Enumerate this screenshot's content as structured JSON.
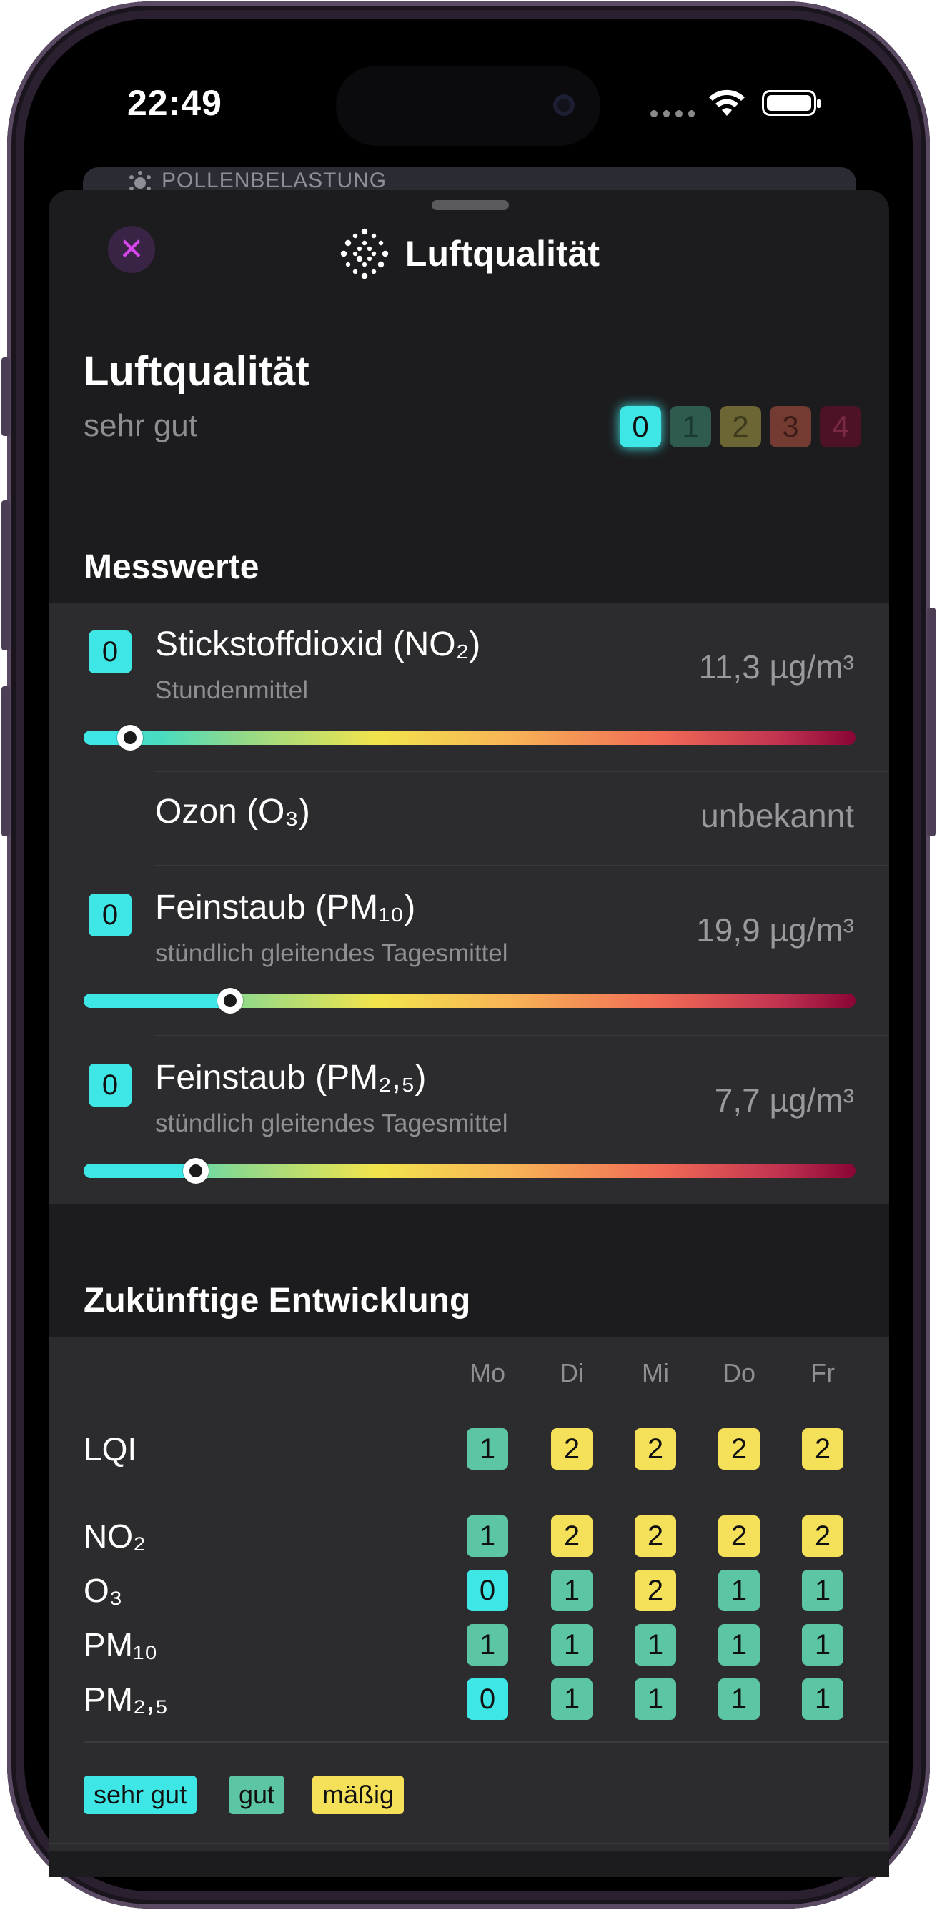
{
  "status": {
    "time": "22:49"
  },
  "behind_sheet": {
    "label": "POLLENBELASTUNG"
  },
  "nav": {
    "title": "Luftqualität"
  },
  "summary": {
    "title": "Luftqualität",
    "rating": "sehr gut",
    "current_index": 0,
    "scale": [
      "0",
      "1",
      "2",
      "3",
      "4"
    ]
  },
  "colors": {
    "c0": "#3ee6e6",
    "c1": "#5cc5a3",
    "c2": "#f5e05a",
    "c3": "#e0533f",
    "c4": "#8a0535"
  },
  "measurements": {
    "heading": "Messwerte",
    "items": [
      {
        "badge": "0",
        "name": "Stickstoffdioxid (NO₂)",
        "sub": "Stundenmittel",
        "value": "11,3 µg/m³",
        "level": 0.06
      },
      {
        "name": "Ozon (O₃)",
        "value": "unbekannt"
      },
      {
        "badge": "0",
        "name": "Feinstaub (PM₁₀)",
        "sub": "stündlich gleitendes Tagesmittel",
        "value": "19,9 µg/m³",
        "level": 0.19
      },
      {
        "badge": "0",
        "name": "Feinstaub (PM₂,₅)",
        "sub": "stündlich gleitendes Tagesmittel",
        "value": "7,7 µg/m³",
        "level": 0.145
      }
    ]
  },
  "forecast": {
    "heading": "Zukünftige Entwicklung",
    "days": [
      "Mo",
      "Di",
      "Mi",
      "Do",
      "Fr"
    ],
    "rows": [
      {
        "label": "LQI",
        "values": [
          "1",
          "2",
          "2",
          "2",
          "2"
        ]
      },
      {
        "label": "NO₂",
        "values": [
          "1",
          "2",
          "2",
          "2",
          "2"
        ]
      },
      {
        "label": "O₃",
        "values": [
          "0",
          "1",
          "2",
          "1",
          "1"
        ]
      },
      {
        "label": "PM₁₀",
        "values": [
          "1",
          "1",
          "1",
          "1",
          "1"
        ]
      },
      {
        "label": "PM₂,₅",
        "values": [
          "0",
          "1",
          "1",
          "1",
          "1"
        ]
      }
    ],
    "legend": [
      "sehr gut",
      "gut",
      "mäßig"
    ]
  }
}
